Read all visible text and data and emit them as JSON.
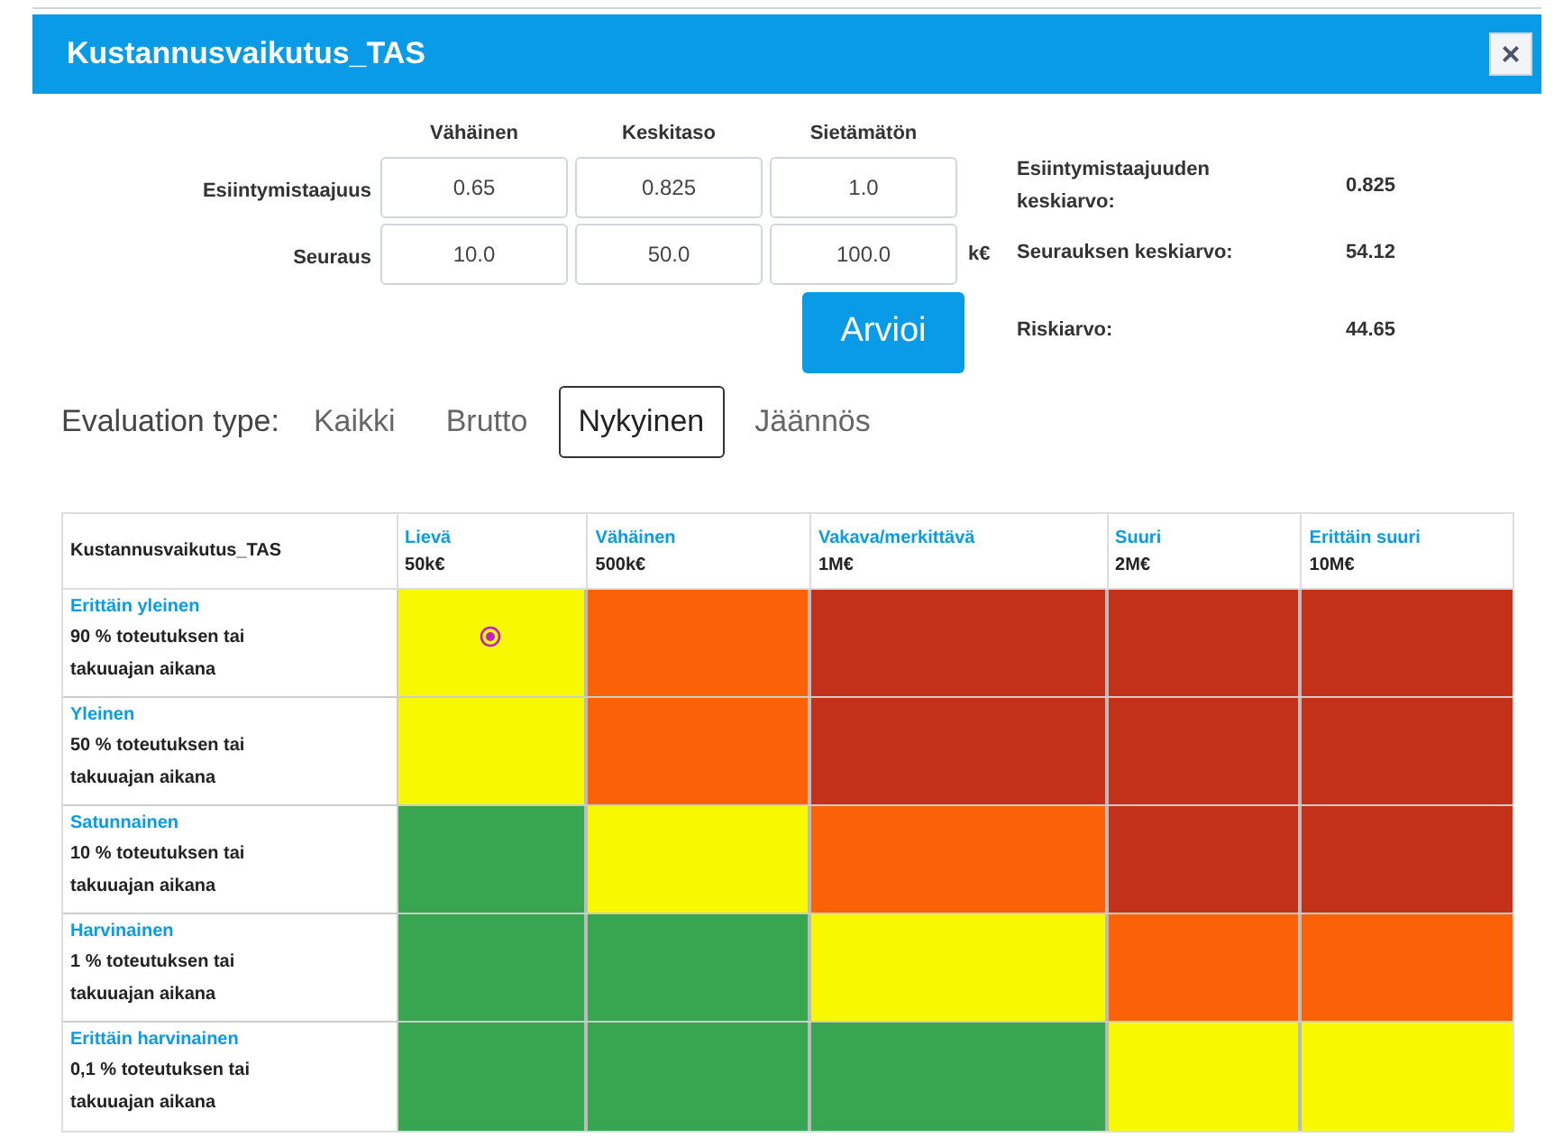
{
  "window": {
    "title": "Kustannusvaikutus_TAS",
    "close": "×"
  },
  "form": {
    "columns": [
      "Vähäinen",
      "Keskitaso",
      "Sietämätön"
    ],
    "rows": [
      {
        "label": "Esiintymistaajuus",
        "values": [
          "0.65",
          "0.825",
          "1.0"
        ]
      },
      {
        "label": "Seuraus",
        "values": [
          "10.0",
          "50.0",
          "100.0"
        ],
        "unit": "k€"
      }
    ],
    "button": "Arvioi",
    "stats": [
      {
        "label": "Esiintymistaajuuden keskiarvo:",
        "value": "0.825"
      },
      {
        "label": "Seurauksen keskiarvo:",
        "value": "54.12"
      },
      {
        "label": "Riskiarvo:",
        "value": "44.65"
      }
    ]
  },
  "evaluation": {
    "label": "Evaluation type:",
    "options": [
      {
        "label": "Kaikki",
        "selected": false
      },
      {
        "label": "Brutto",
        "selected": false
      },
      {
        "label": "Nykyinen",
        "selected": true
      },
      {
        "label": "Jäännös",
        "selected": false
      }
    ]
  },
  "matrix": {
    "corner": "Kustannusvaikutus_TAS",
    "columns": [
      {
        "name": "Lievä",
        "amount": "50k€"
      },
      {
        "name": "Vähäinen",
        "amount": "500k€"
      },
      {
        "name": "Vakava/merkittävä",
        "amount": "1M€"
      },
      {
        "name": "Suuri",
        "amount": "2M€"
      },
      {
        "name": "Erittäin suuri",
        "amount": "10M€"
      }
    ],
    "rows": [
      {
        "name": "Erittäin yleinen",
        "description": "90 % toteutuksen tai takuuajan aikana",
        "cells": [
          {
            "color": "#f8f800",
            "marked": true
          },
          {
            "color": "#fb6207",
            "marked": false
          },
          {
            "color": "#c3311a",
            "marked": false
          },
          {
            "color": "#c3311a",
            "marked": false
          },
          {
            "color": "#c3311a",
            "marked": false
          }
        ]
      },
      {
        "name": "Yleinen",
        "description": "50 % toteutuksen tai takuuajan aikana",
        "cells": [
          {
            "color": "#f8f800",
            "marked": false
          },
          {
            "color": "#fb6207",
            "marked": false
          },
          {
            "color": "#c3311a",
            "marked": false
          },
          {
            "color": "#c3311a",
            "marked": false
          },
          {
            "color": "#c3311a",
            "marked": false
          }
        ]
      },
      {
        "name": "Satunnainen",
        "description": "10 % toteutuksen tai takuuajan aikana",
        "cells": [
          {
            "color": "#38a550",
            "marked": false
          },
          {
            "color": "#f8f800",
            "marked": false
          },
          {
            "color": "#fb6207",
            "marked": false
          },
          {
            "color": "#c3311a",
            "marked": false
          },
          {
            "color": "#c3311a",
            "marked": false
          }
        ]
      },
      {
        "name": "Harvinainen",
        "description": "1 % toteutuksen tai takuuajan aikana",
        "cells": [
          {
            "color": "#38a550",
            "marked": false
          },
          {
            "color": "#38a550",
            "marked": false
          },
          {
            "color": "#f8f800",
            "marked": false
          },
          {
            "color": "#fb6207",
            "marked": false
          },
          {
            "color": "#fb6207",
            "marked": false
          }
        ]
      },
      {
        "name": "Erittäin harvinainen",
        "description": "0,1 % toteutuksen tai takuuajan aikana",
        "cells": [
          {
            "color": "#38a550",
            "marked": false
          },
          {
            "color": "#38a550",
            "marked": false
          },
          {
            "color": "#38a550",
            "marked": false
          },
          {
            "color": "#f8f800",
            "marked": false
          },
          {
            "color": "#f8f800",
            "marked": false
          }
        ]
      }
    ]
  }
}
